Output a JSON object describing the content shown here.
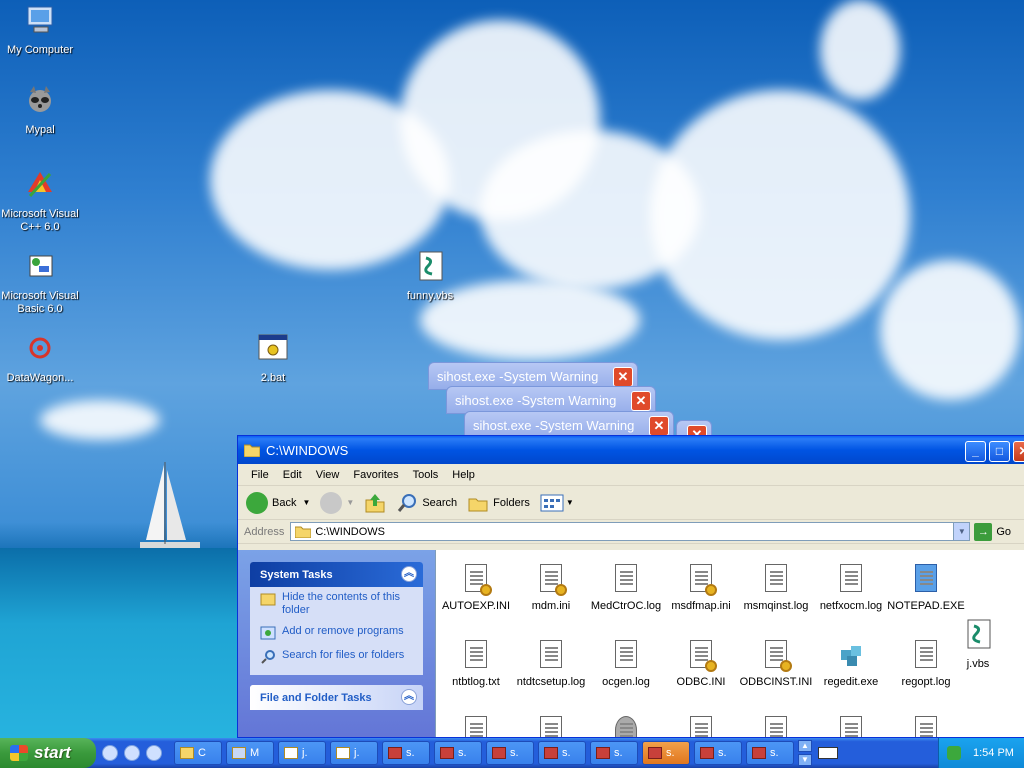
{
  "desktop": {
    "icons": [
      {
        "label": "My Computer"
      },
      {
        "label": "Mypal"
      },
      {
        "label": "Microsoft Visual C++ 6.0"
      },
      {
        "label": "Microsoft Visual Basic 6.0"
      },
      {
        "label": "DataWagon..."
      },
      {
        "label": "funny.vbs"
      },
      {
        "label": "2.bat"
      },
      {
        "label": "j.vbs"
      }
    ]
  },
  "warnings": [
    {
      "title": "sihost.exe -System Warning"
    },
    {
      "title": "sihost.exe -System Warning"
    },
    {
      "title": "sihost.exe -System Warning"
    }
  ],
  "explorer": {
    "title": "C:\\WINDOWS",
    "menu": [
      "File",
      "Edit",
      "View",
      "Favorites",
      "Tools",
      "Help"
    ],
    "toolbar": {
      "back": "Back",
      "search": "Search",
      "folders": "Folders"
    },
    "address": {
      "label": "Address",
      "value": "C:\\WINDOWS",
      "go": "Go"
    },
    "system_tasks": {
      "title": "System Tasks",
      "items": [
        "Hide the contents of this folder",
        "Add or remove programs",
        "Search for files or folders"
      ]
    },
    "file_folder_tasks": {
      "title": "File and Folder Tasks"
    },
    "files": [
      {
        "name": "AUTOEXP.INI",
        "icon": "ini-icon"
      },
      {
        "name": "mdm.ini",
        "icon": "ini-icon"
      },
      {
        "name": "MedCtrOC.log",
        "icon": "log-icon"
      },
      {
        "name": "msdfmap.ini",
        "icon": "ini-icon"
      },
      {
        "name": "msmqinst.log",
        "icon": "log-icon"
      },
      {
        "name": "netfxocm.log",
        "icon": "log-icon"
      },
      {
        "name": "NOTEPAD.EXE",
        "icon": "notepad-icon"
      },
      {
        "name": "ntbtlog.txt",
        "icon": "log-icon"
      },
      {
        "name": "ntdtcsetup.log",
        "icon": "log-icon"
      },
      {
        "name": "ocgen.log",
        "icon": "log-icon"
      },
      {
        "name": "ODBC.INI",
        "icon": "ini-icon"
      },
      {
        "name": "ODBCINST.INI",
        "icon": "ini-icon"
      },
      {
        "name": "regedit.exe",
        "icon": "regedit-icon"
      },
      {
        "name": "regopt.log",
        "icon": "log-icon"
      }
    ]
  },
  "taskbar": {
    "start": "start",
    "tasks": [
      {
        "label": "C",
        "icon": "folder-icon"
      },
      {
        "label": "M",
        "icon": "app-icon"
      },
      {
        "label": "j.",
        "icon": "script-icon"
      },
      {
        "label": "j.",
        "icon": "script-icon"
      },
      {
        "label": "s.",
        "icon": "warning-icon"
      },
      {
        "label": "s.",
        "icon": "warning-icon"
      },
      {
        "label": "s.",
        "icon": "warning-icon"
      },
      {
        "label": "s.",
        "icon": "warning-icon"
      },
      {
        "label": "s.",
        "icon": "warning-icon"
      },
      {
        "label": "s.",
        "icon": "warning-icon",
        "active": true
      },
      {
        "label": "s.",
        "icon": "warning-icon"
      },
      {
        "label": "s.",
        "icon": "warning-icon"
      }
    ],
    "clock": "1:54 PM"
  }
}
